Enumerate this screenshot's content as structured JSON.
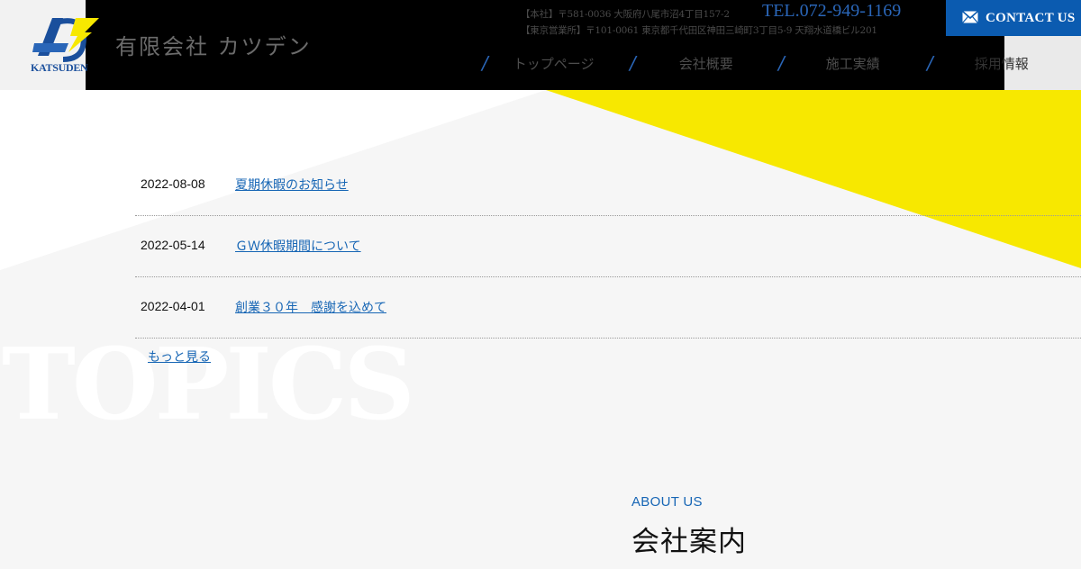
{
  "header": {
    "logo_text": "KATSUDEN",
    "company_name": "有限会社 カツデン",
    "address_head_office": "【本社】〒581-0036 大阪府八尾市沼4丁目157-2",
    "address_tokyo_office": "【東京営業所】〒101-0061 東京都千代田区神田三崎町3丁目5-9 天翔水道橋ビル201",
    "tel": "TEL.072-949-1169",
    "contact_label": "CONTACT US",
    "contact_icon": "mail-icon"
  },
  "nav": {
    "items": [
      {
        "label": "トップページ"
      },
      {
        "label": "会社概要"
      },
      {
        "label": "施工実績"
      },
      {
        "label": "採用情報"
      }
    ]
  },
  "topics": {
    "watermark": "TOPICS",
    "items": [
      {
        "date": "2022-08-08",
        "title": "夏期休暇のお知らせ"
      },
      {
        "date": "2022-05-14",
        "title": "ＧＷ休暇期間について"
      },
      {
        "date": "2022-04-01",
        "title": "創業３０年　感謝を込めて"
      }
    ],
    "more_label": "もっと見る"
  },
  "about": {
    "label_en": "ABOUT US",
    "label_jp": "会社案内"
  },
  "colors": {
    "accent_blue": "#1766b5",
    "brand_blue": "#0b5bb0",
    "accent_yellow": "#f7e800",
    "header_black": "#000000"
  }
}
